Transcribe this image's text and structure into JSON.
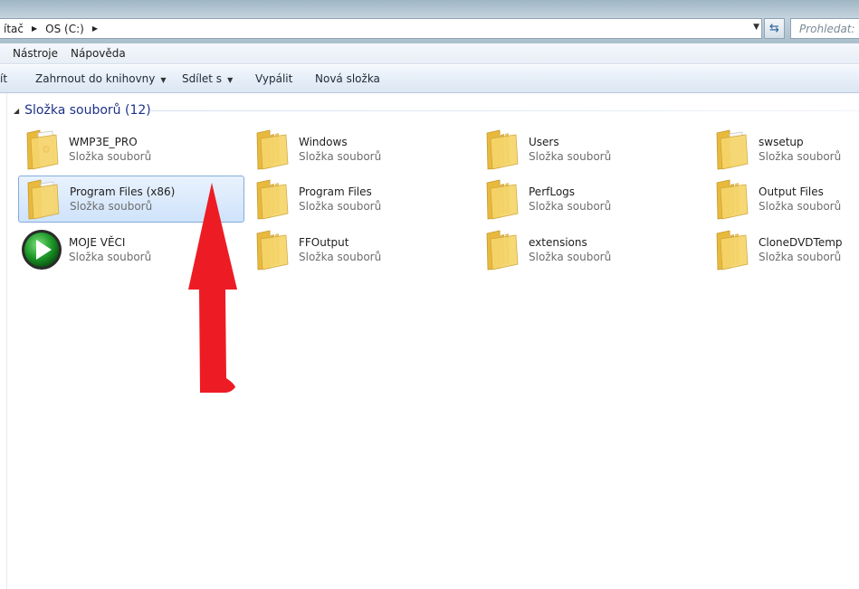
{
  "window": {
    "breadcrumb": [
      "ítač",
      "OS (C:)"
    ],
    "search_placeholder": "Prohledat: O",
    "colors": {
      "accent": "#1e3287",
      "selection": "#cfe3fb",
      "folder": "#f2c94c",
      "annotation_arrow": "#ed1c24"
    }
  },
  "menu": {
    "items": [
      "Nástroje",
      "Nápověda"
    ]
  },
  "commands": {
    "partial": "ít",
    "include_library": "Zahrnout do knihovny",
    "share": "Sdílet s",
    "burn": "Vypálit",
    "new_folder": "Nová složka"
  },
  "group": {
    "title": "Složka souborů (12)"
  },
  "items": [
    {
      "name": "WMP3E_PRO",
      "type": "Složka souborů",
      "icon": "folder-doc-icon"
    },
    {
      "name": "Windows",
      "type": "Složka souborů",
      "icon": "folder-icon"
    },
    {
      "name": "Users",
      "type": "Složka souborů",
      "icon": "folder-icon"
    },
    {
      "name": "swsetup",
      "type": "Složka souborů",
      "icon": "folder-paper-icon"
    },
    {
      "name": "Program Files (x86)",
      "type": "Složka souborů",
      "icon": "folder-paper-icon",
      "selected": true
    },
    {
      "name": "Program Files",
      "type": "Složka souborů",
      "icon": "folder-icon"
    },
    {
      "name": "PerfLogs",
      "type": "Složka souborů",
      "icon": "folder-icon"
    },
    {
      "name": "Output Files",
      "type": "Složka souborů",
      "icon": "folder-icon"
    },
    {
      "name": "MOJE VĚCI",
      "type": "Složka souborů",
      "icon": "play-icon"
    },
    {
      "name": "FFOutput",
      "type": "Složka souborů",
      "icon": "folder-icon"
    },
    {
      "name": "extensions",
      "type": "Složka souborů",
      "icon": "folder-icon"
    },
    {
      "name": "CloneDVDTemp",
      "type": "Složka souborů",
      "icon": "folder-icon"
    }
  ]
}
